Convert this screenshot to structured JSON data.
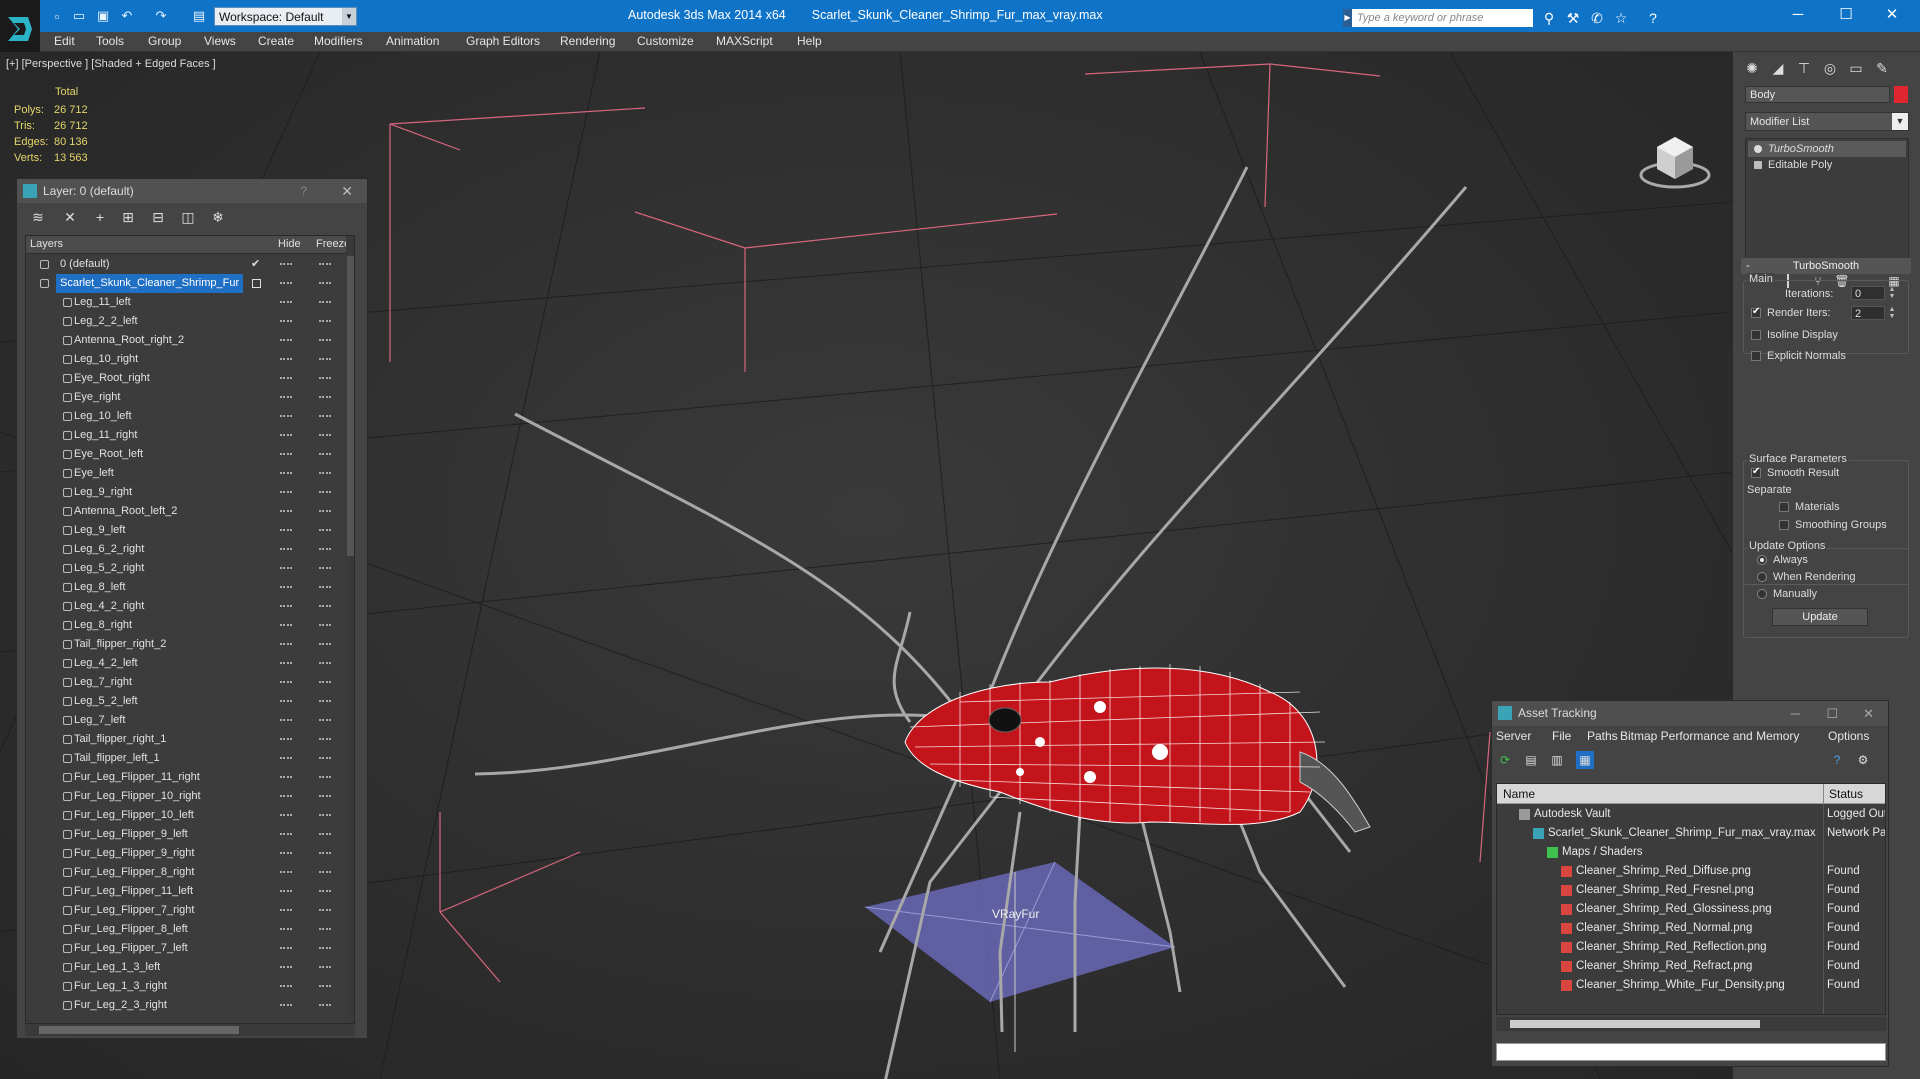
{
  "titlebar": {
    "workspace_label": "Workspace: Default",
    "app_name": "Autodesk 3ds Max  2014 x64",
    "file_name": "Scarlet_Skunk_Cleaner_Shrimp_Fur_max_vray.max",
    "search_placeholder": "Type a keyword or phrase"
  },
  "menu": [
    "Edit",
    "Tools",
    "Group",
    "Views",
    "Create",
    "Modifiers",
    "Animation",
    "Graph Editors",
    "Rendering",
    "Customize",
    "MAXScript",
    "Help"
  ],
  "viewport": {
    "label": "[+] [Perspective ] [Shaded + Edged Faces ]",
    "stats_total": "Total",
    "stats": [
      {
        "label": "Polys:",
        "value": "26 712"
      },
      {
        "label": "Tris:",
        "value": "26 712"
      },
      {
        "label": "Edges:",
        "value": "80 136"
      },
      {
        "label": "Verts:",
        "value": "13 563"
      }
    ],
    "object_label": "VRayFur"
  },
  "layer_panel": {
    "title": "Layer: 0 (default)",
    "help": "?",
    "col_layers": "Layers",
    "col_hide": "Hide",
    "col_freeze": "Freeze",
    "rows": [
      {
        "name": "0 (default)",
        "type": "parent",
        "checked": true
      },
      {
        "name": "Scarlet_Skunk_Cleaner_Shrimp_Fur",
        "type": "selected"
      },
      {
        "name": "Leg_11_left",
        "type": "child"
      },
      {
        "name": "Leg_2_2_left",
        "type": "child"
      },
      {
        "name": "Antenna_Root_right_2",
        "type": "child"
      },
      {
        "name": "Leg_10_right",
        "type": "child"
      },
      {
        "name": "Eye_Root_right",
        "type": "child"
      },
      {
        "name": "Eye_right",
        "type": "child"
      },
      {
        "name": "Leg_10_left",
        "type": "child"
      },
      {
        "name": "Leg_11_right",
        "type": "child"
      },
      {
        "name": "Eye_Root_left",
        "type": "child"
      },
      {
        "name": "Eye_left",
        "type": "child"
      },
      {
        "name": "Leg_9_right",
        "type": "child"
      },
      {
        "name": "Antenna_Root_left_2",
        "type": "child"
      },
      {
        "name": "Leg_9_left",
        "type": "child"
      },
      {
        "name": "Leg_6_2_right",
        "type": "child"
      },
      {
        "name": "Leg_5_2_right",
        "type": "child"
      },
      {
        "name": "Leg_8_left",
        "type": "child"
      },
      {
        "name": "Leg_4_2_right",
        "type": "child"
      },
      {
        "name": "Leg_8_right",
        "type": "child"
      },
      {
        "name": "Tail_flipper_right_2",
        "type": "child"
      },
      {
        "name": "Leg_4_2_left",
        "type": "child"
      },
      {
        "name": "Leg_7_right",
        "type": "child"
      },
      {
        "name": "Leg_5_2_left",
        "type": "child"
      },
      {
        "name": "Leg_7_left",
        "type": "child"
      },
      {
        "name": "Tail_flipper_right_1",
        "type": "child"
      },
      {
        "name": "Tail_flipper_left_1",
        "type": "child"
      },
      {
        "name": "Fur_Leg_Flipper_11_right",
        "type": "child"
      },
      {
        "name": "Fur_Leg_Flipper_10_right",
        "type": "child"
      },
      {
        "name": "Fur_Leg_Flipper_10_left",
        "type": "child"
      },
      {
        "name": "Fur_Leg_Flipper_9_left",
        "type": "child"
      },
      {
        "name": "Fur_Leg_Flipper_9_right",
        "type": "child"
      },
      {
        "name": "Fur_Leg_Flipper_8_right",
        "type": "child"
      },
      {
        "name": "Fur_Leg_Flipper_11_left",
        "type": "child"
      },
      {
        "name": "Fur_Leg_Flipper_7_right",
        "type": "child"
      },
      {
        "name": "Fur_Leg_Flipper_8_left",
        "type": "child"
      },
      {
        "name": "Fur_Leg_Flipper_7_left",
        "type": "child"
      },
      {
        "name": "Fur_Leg_1_3_left",
        "type": "child"
      },
      {
        "name": "Fur_Leg_1_3_right",
        "type": "child"
      },
      {
        "name": "Fur_Leg_2_3_right",
        "type": "child"
      }
    ]
  },
  "command_panel": {
    "object_name": "Body",
    "object_color": "#e0262e",
    "modifier_list": "Modifier List",
    "stack": [
      "TurboSmooth",
      "Editable Poly"
    ],
    "rollout_title": "TurboSmooth",
    "main_label": "Main",
    "iterations_label": "Iterations:",
    "iterations_value": "0",
    "render_iters_label": "Render Iters:",
    "render_iters_value": "2",
    "isoline_label": "Isoline Display",
    "explicit_label": "Explicit Normals",
    "surface_label": "Surface Parameters",
    "smooth_label": "Smooth Result",
    "separate_label": "Separate",
    "materials_label": "Materials",
    "smoothing_label": "Smoothing Groups",
    "update_options_label": "Update Options",
    "always_label": "Always",
    "when_rendering_label": "When Rendering",
    "manually_label": "Manually",
    "update_button": "Update"
  },
  "asset_tracking": {
    "title": "Asset Tracking",
    "menu": [
      "Server",
      "File",
      "Paths",
      "Bitmap Performance and Memory",
      "Options"
    ],
    "col_name": "Name",
    "col_status": "Status",
    "rows": [
      {
        "name": "Autodesk Vault",
        "status": "Logged Out",
        "indent": 1,
        "icon": "vault"
      },
      {
        "name": "Scarlet_Skunk_Cleaner_Shrimp_Fur_max_vray.max",
        "status": "Network Pa",
        "indent": 2,
        "icon": "max"
      },
      {
        "name": "Maps / Shaders",
        "status": "",
        "indent": 3,
        "icon": "folder"
      },
      {
        "name": "Cleaner_Shrimp_Red_Diffuse.png",
        "status": "Found",
        "indent": 4,
        "icon": "png"
      },
      {
        "name": "Cleaner_Shrimp_Red_Fresnel.png",
        "status": "Found",
        "indent": 4,
        "icon": "png"
      },
      {
        "name": "Cleaner_Shrimp_Red_Glossiness.png",
        "status": "Found",
        "indent": 4,
        "icon": "png"
      },
      {
        "name": "Cleaner_Shrimp_Red_Normal.png",
        "status": "Found",
        "indent": 4,
        "icon": "png"
      },
      {
        "name": "Cleaner_Shrimp_Red_Reflection.png",
        "status": "Found",
        "indent": 4,
        "icon": "png"
      },
      {
        "name": "Cleaner_Shrimp_Red_Refract.png",
        "status": "Found",
        "indent": 4,
        "icon": "png"
      },
      {
        "name": "Cleaner_Shrimp_White_Fur_Density.png",
        "status": "Found",
        "indent": 4,
        "icon": "png"
      }
    ]
  }
}
